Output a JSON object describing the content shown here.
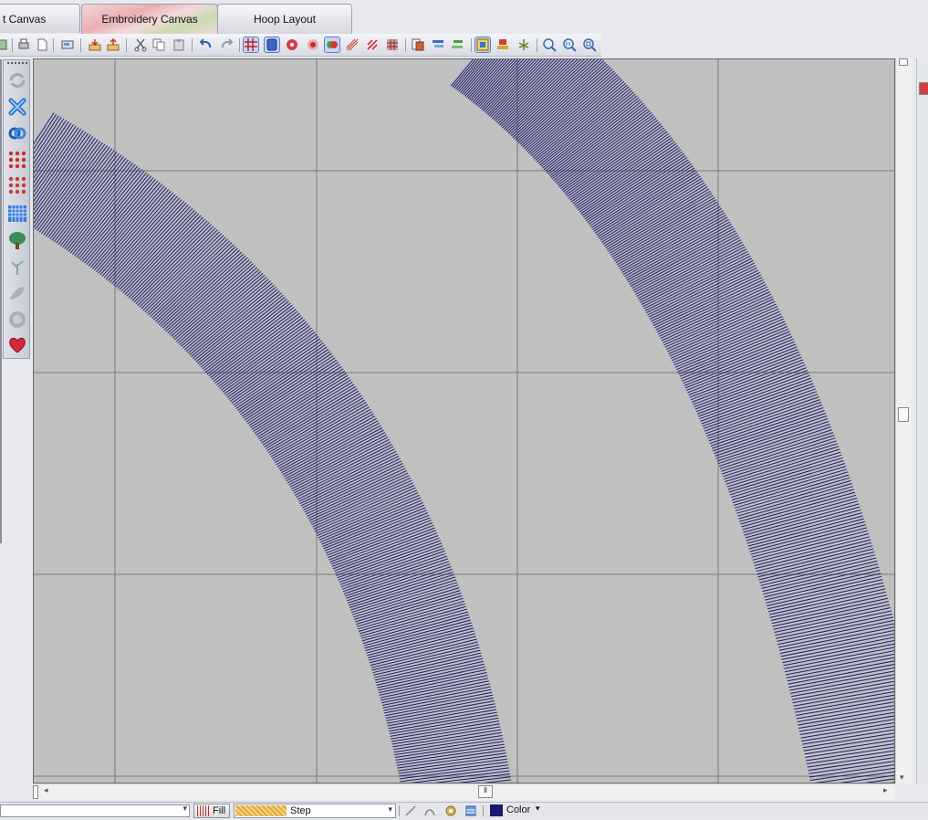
{
  "tabs": [
    {
      "label": "t Canvas",
      "active": false
    },
    {
      "label": "Embroidery Canvas",
      "active": true
    },
    {
      "label": "Hoop Layout",
      "active": false
    }
  ],
  "toolbar": {
    "icons": [
      "new-icon",
      "print-icon",
      "page-icon",
      "print-preview-icon",
      "import-icon",
      "export-icon",
      "cut-icon",
      "copy-icon",
      "paste-icon",
      "undo-icon",
      "redo-icon",
      "grid-icon",
      "hoop-icon",
      "sew-simulator-icon",
      "stitch-points-icon",
      "color-view-icon",
      "stitch-view-icon",
      "density-icon",
      "grid-view-icon",
      "copy-object-icon",
      "sort-icon",
      "align-icon",
      "select-all-icon",
      "stamp-icon",
      "tree-icon",
      "zoom-in-icon",
      "zoom-actual-icon",
      "zoom-out-icon"
    ]
  },
  "palette": {
    "tools": [
      "rotate-icon",
      "cross-stitch-icon",
      "knot-icon",
      "dot-grid-icon",
      "dot-grid-alt-icon",
      "grid-fill-icon",
      "tree-shape-icon",
      "leaf-icon",
      "feather-icon",
      "circle-icon",
      "heart-icon"
    ]
  },
  "statusbar": {
    "object_value": "",
    "fill_label": "Fill",
    "step_label": "Step",
    "color_label": "Color"
  },
  "colors": {
    "stitch": "#1a1a6e",
    "canvas": "#c0c0c0",
    "grid": "#7a7a7a",
    "tab_active": "#e9b0b3"
  }
}
